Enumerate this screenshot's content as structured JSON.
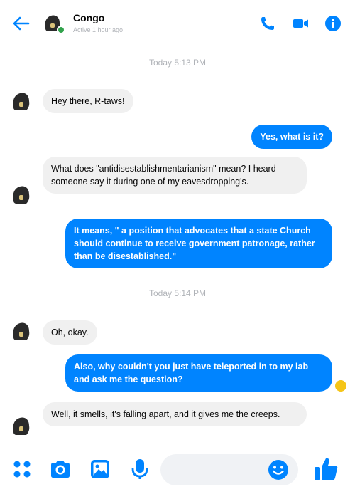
{
  "header": {
    "contact_name": "Congo",
    "status": "Active 1 hour ago",
    "icons": [
      "back-arrow-icon",
      "phone-icon",
      "video-camera-icon",
      "info-icon"
    ]
  },
  "colors": {
    "accent": "#0084ff",
    "incoming_bubble": "#f0f0f0",
    "online": "#31a24c",
    "timestamp": "#b0b3b8"
  },
  "timestamps": [
    "Today 5:13 PM",
    "Today 5:14 PM"
  ],
  "messages": [
    {
      "from": "Congo",
      "direction": "in",
      "text": "Hey there, R-taws!"
    },
    {
      "from": "me",
      "direction": "out",
      "text": "Yes, what is it?"
    },
    {
      "from": "Congo",
      "direction": "in",
      "text": "What does \"antidisestablishmentarianism\" mean? I heard someone say it during one of my eavesdropping's."
    },
    {
      "from": "me",
      "direction": "out",
      "text": "It means, \" a position that advocates that a state Church should continue to receive government patronage, rather than be disestablished.\""
    },
    {
      "from": "Congo",
      "direction": "in",
      "text": "Oh, okay."
    },
    {
      "from": "me",
      "direction": "out",
      "text": "Also, why couldn't you just have teleported in to my lab and ask me the question?"
    },
    {
      "from": "Congo",
      "direction": "in",
      "text": "Well, it smells, it's falling apart, and it gives me the creeps."
    }
  ],
  "composer": {
    "input_value": "",
    "placeholder": "",
    "icons": [
      "apps-grid-icon",
      "camera-icon",
      "gallery-icon",
      "microphone-icon",
      "emoji-icon",
      "thumbs-up-icon"
    ]
  }
}
